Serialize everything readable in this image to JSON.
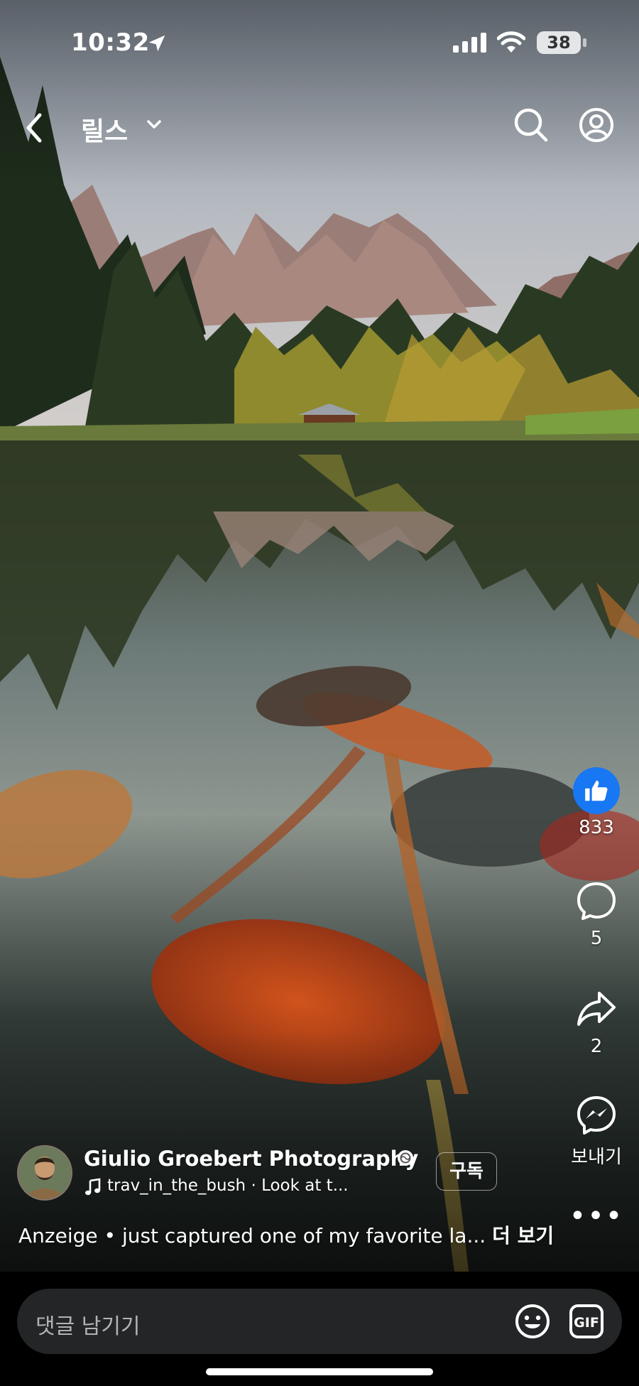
{
  "status_bar": {
    "time": "10:32",
    "battery": "38"
  },
  "nav": {
    "title": "릴스"
  },
  "actions": {
    "like_count": "833",
    "comment_count": "5",
    "share_count": "2",
    "send_label": "보내기"
  },
  "author": {
    "name": "Giulio Groebert Photography",
    "music": "trav_in_the_bush · Look at t...",
    "subscribe_label": "구독"
  },
  "caption": {
    "sponsored": "Anzeige",
    "text": "just captured one of my favorite la...",
    "more": "더 보기"
  },
  "comment_bar": {
    "placeholder": "댓글 남기기"
  },
  "colors": {
    "like_blue": "#1877f2",
    "comment_field": "#242526"
  },
  "icons": [
    "location-arrow-icon",
    "signal-icon",
    "wifi-icon",
    "back-icon",
    "chevron-down-icon",
    "search-icon",
    "profile-icon",
    "thumbs-up-icon",
    "comment-icon",
    "share-icon",
    "messenger-icon",
    "more-icon",
    "verified-icon",
    "music-note-icon",
    "emoji-icon",
    "gif-icon"
  ]
}
